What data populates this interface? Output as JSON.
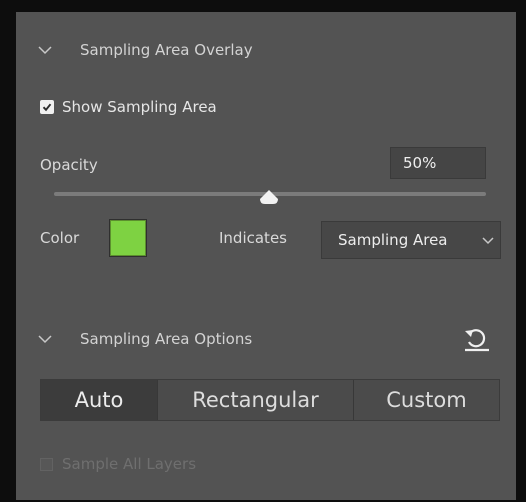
{
  "overlay": {
    "header": "Sampling Area Overlay",
    "show_sampling_area_label": "Show Sampling Area",
    "show_sampling_area_checked": true,
    "opacity_label": "Opacity",
    "opacity_value": "50%",
    "opacity_level_percent": 50,
    "color_label": "Color",
    "color_hex": "#7ed242",
    "indicates_label": "Indicates",
    "indicates_value": "Sampling Area"
  },
  "options": {
    "header": "Sampling Area Options",
    "modes": [
      "Auto",
      "Rectangular",
      "Custom"
    ],
    "active_mode": "Auto",
    "sample_all_layers_label": "Sample All Layers",
    "sample_all_layers_enabled": false
  },
  "icons": {
    "collapse": "chevron-down-icon",
    "reset": "reset-icon",
    "slider": "slider-thumb-icon"
  }
}
